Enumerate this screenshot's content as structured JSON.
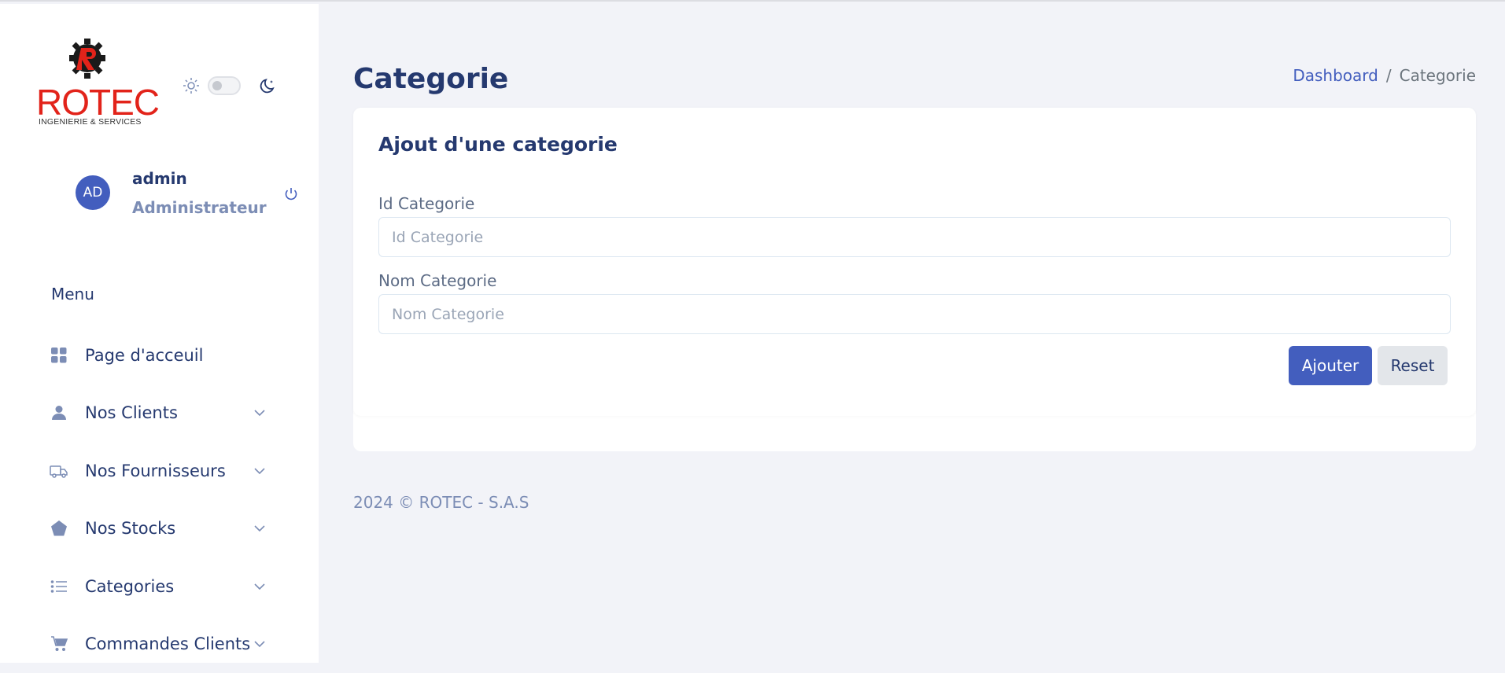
{
  "brand": {
    "name": "ROTEC",
    "tagline": "INGENIERIE & SERVICES",
    "logo_color": "#e2231a"
  },
  "theme": {
    "light_icon": "sun-icon",
    "dark_icon": "moon-icon",
    "dark_mode": false
  },
  "user": {
    "initials": "AD",
    "name": "admin",
    "role": "Administrateur",
    "logout_icon": "power-icon"
  },
  "menu": {
    "title": "Menu",
    "items": [
      {
        "label": "Page d'acceuil",
        "icon": "grid-icon",
        "has_submenu": false
      },
      {
        "label": "Nos Clients",
        "icon": "person-icon",
        "has_submenu": true
      },
      {
        "label": "Nos Fournisseurs",
        "icon": "truck-icon",
        "has_submenu": true
      },
      {
        "label": "Nos Stocks",
        "icon": "pentagon-icon",
        "has_submenu": true
      },
      {
        "label": "Categories",
        "icon": "list-icon",
        "has_submenu": true
      },
      {
        "label": "Commandes Clients",
        "icon": "cart-icon",
        "has_submenu": true
      }
    ]
  },
  "page": {
    "title": "Categorie",
    "breadcrumb": {
      "link": "Dashboard",
      "separator": "/",
      "current": "Categorie"
    }
  },
  "form": {
    "title": "Ajout d'une categorie",
    "fields": [
      {
        "label": "Id Categorie",
        "placeholder": "Id Categorie",
        "value": ""
      },
      {
        "label": "Nom Categorie",
        "placeholder": "Nom Categorie",
        "value": ""
      }
    ],
    "submit_label": "Ajouter",
    "reset_label": "Reset"
  },
  "footer": {
    "text": "2024 © ROTEC - S.A.S"
  },
  "colors": {
    "accent": "#435ebe",
    "text": "#25396f",
    "muted": "#7c8db5",
    "background": "#f2f3f8"
  }
}
